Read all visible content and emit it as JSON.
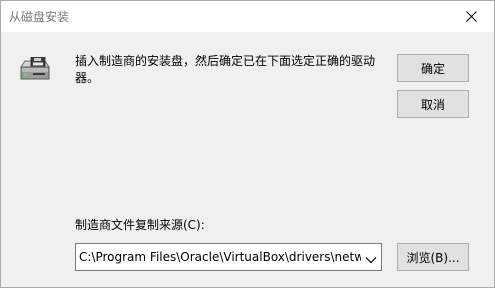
{
  "window": {
    "title": "从磁盘安装"
  },
  "icons": {
    "close": "close-icon",
    "disk": "floppy-disk-icon",
    "dropdown": "chevron-down-icon"
  },
  "message": {
    "text": "插入制造商的安装盘，然后确定已在下面选定正确的驱动器。"
  },
  "buttons": {
    "ok": "确定",
    "cancel": "取消",
    "browse": "浏览(B)..."
  },
  "source": {
    "label": "制造商文件复制来源(C):",
    "path": "C:\\Program Files\\Oracle\\VirtualBox\\drivers\\network"
  },
  "colors": {
    "background": "#f0f0f0",
    "titlebar": "#ffffff",
    "button_face": "#e1e1e1",
    "button_border": "#adadad"
  }
}
